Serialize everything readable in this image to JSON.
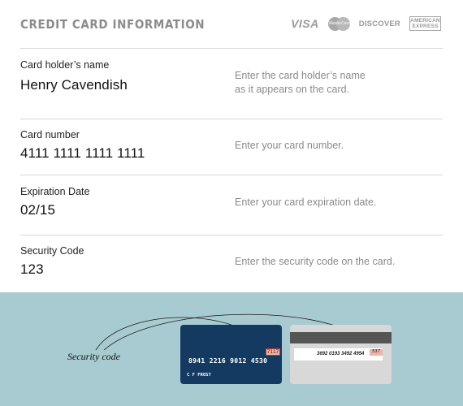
{
  "header": {
    "title": "CREDIT CARD INFORMATION",
    "brands": {
      "visa": "VISA",
      "mastercard": "MasterCard",
      "discover": "DISCOVER",
      "amex_line1": "AMERICAN",
      "amex_line2": "EXPRESS"
    }
  },
  "fields": {
    "name": {
      "label": "Card holder’s name",
      "value": "Henry Cavendish",
      "help_line1": "Enter the card holder’s name",
      "help_line2": "as it appears on the card."
    },
    "number": {
      "label": "Card number",
      "value": "4111 1111 1111 1111",
      "help": "Enter your card number."
    },
    "expiration": {
      "label": "Expiration Date",
      "value": "02/15",
      "help": "Enter your card expiration date."
    },
    "security": {
      "label": "Security Code",
      "value": "123",
      "help": "Enter the security code on the card."
    }
  },
  "illustration": {
    "caption": "Security code",
    "front_card": {
      "cvv": "7117",
      "number": "8941 2216 9012 4530",
      "holder": "C F FROST"
    },
    "back_card": {
      "signature_number": "3692 0193 3492 4954",
      "cvv": "537"
    },
    "colors": {
      "panel_background": "#a8cbd2",
      "front_card": "#153a62",
      "back_card": "#d8d8d8",
      "cvv_highlight": "#f0b3a8"
    }
  }
}
